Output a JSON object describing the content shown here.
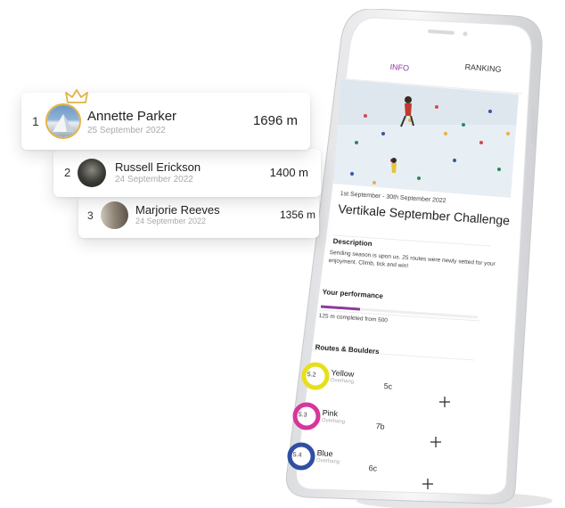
{
  "ranking": [
    {
      "rank": "1",
      "name": "Annette Parker",
      "date": "25 September 2022",
      "distance": "1696 m"
    },
    {
      "rank": "2",
      "name": "Russell Erickson",
      "date": "24 September 2022",
      "distance": "1400 m"
    },
    {
      "rank": "3",
      "name": "Marjorie Reeves",
      "date": "24 September 2022",
      "distance": "1356 m"
    }
  ],
  "app": {
    "tabs": {
      "info": "INFO",
      "ranking": "RANKING"
    },
    "event_dates": "1st September - 30th September 2022",
    "event_title": "Vertikale September Challenge",
    "description_heading": "Description",
    "description_line1": "Sending season is upon us. 25 routes were newly setted for your",
    "description_line2": "enjoyment. Climb, tick and win!",
    "performance_heading": "Your performance",
    "performance_text": "125 m completed from 500",
    "performance_progress": 0.25,
    "routes_heading": "Routes & Boulders",
    "routes": [
      {
        "grade_circle": "5.2",
        "color_name": "Yellow",
        "type": "Overhang",
        "grade": "5c",
        "color": "#e8df1c"
      },
      {
        "grade_circle": "5.3",
        "color_name": "Pink",
        "type": "Overhang",
        "grade": "7b",
        "color": "#d6369c"
      },
      {
        "grade_circle": "5.4",
        "color_name": "Blue",
        "type": "Overhang",
        "grade": "6c",
        "color": "#2f4fa3"
      }
    ]
  },
  "colors": {
    "accent": "#8e3a9e",
    "gold": "#e1b348"
  }
}
